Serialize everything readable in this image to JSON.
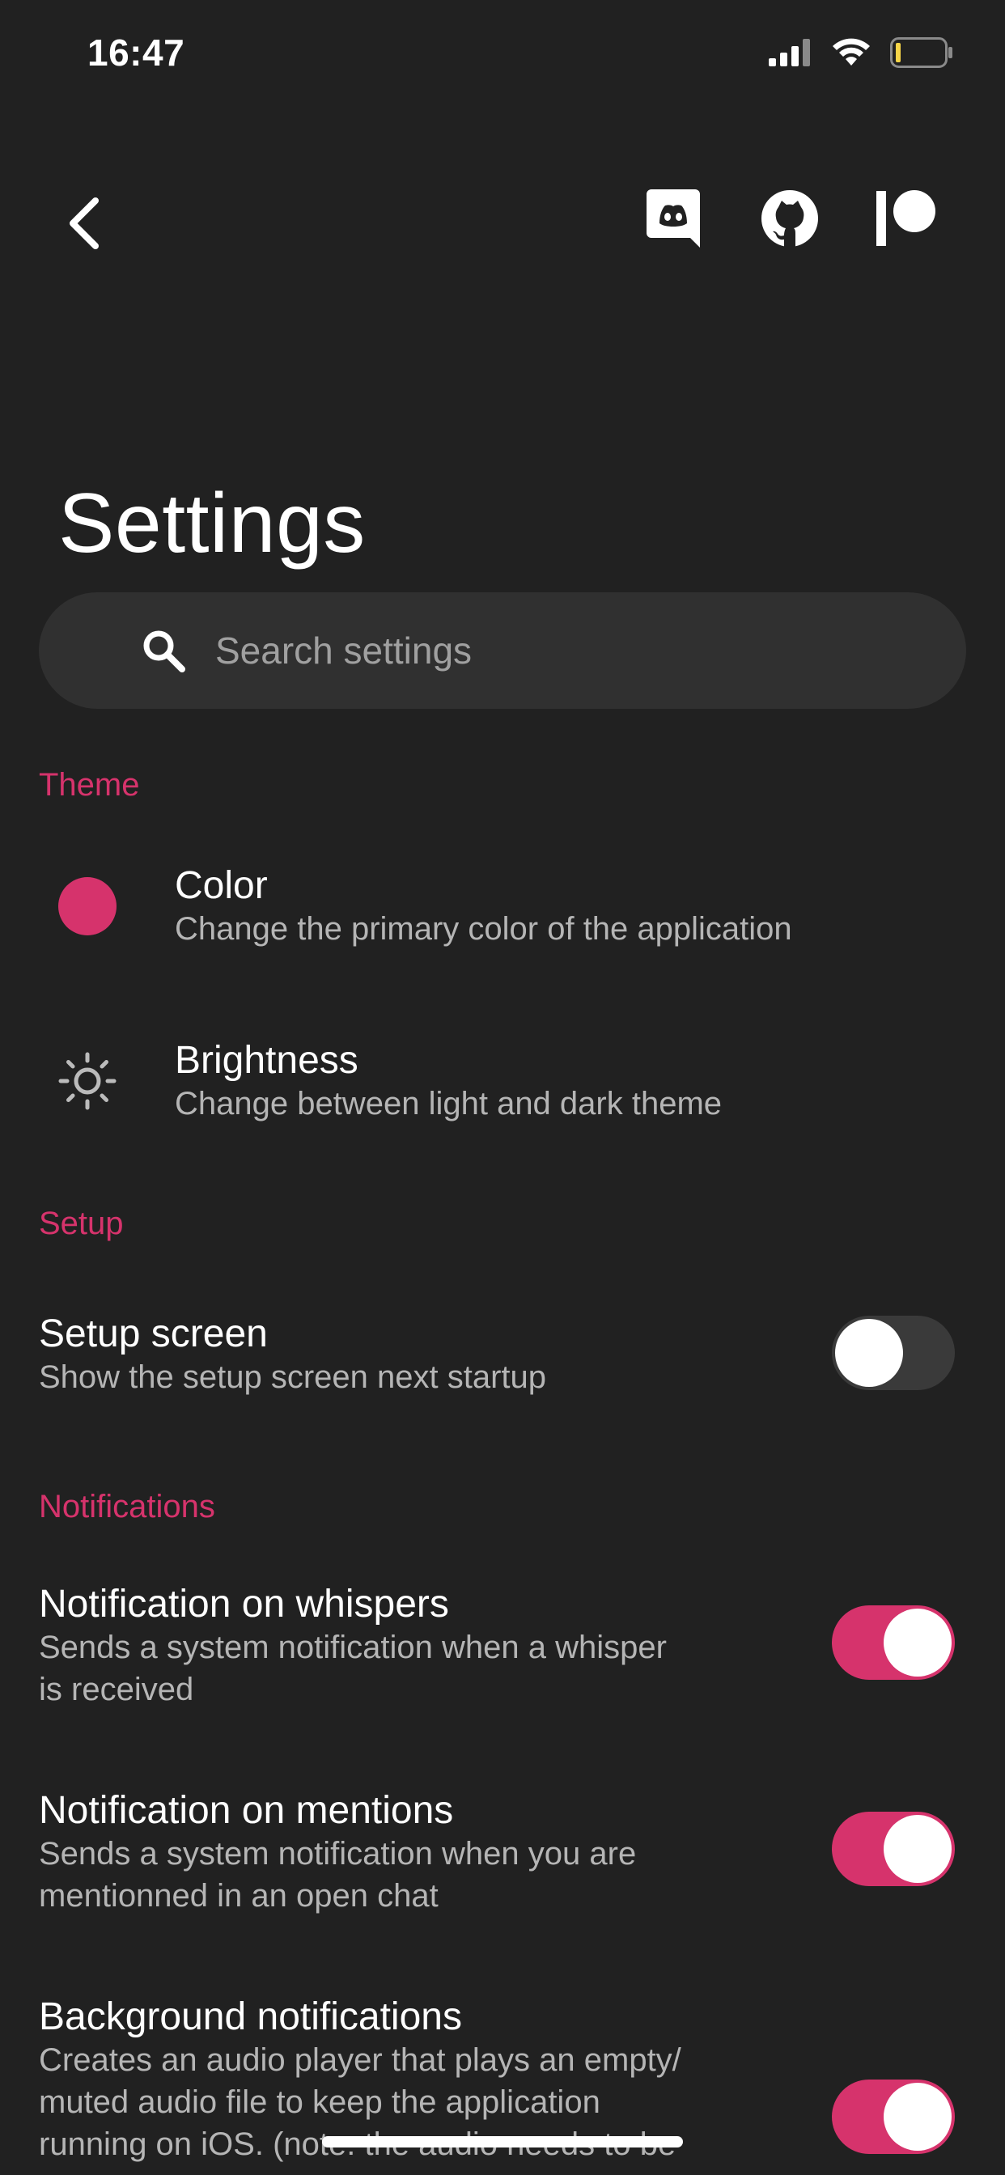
{
  "status_bar": {
    "time": "16:47",
    "icons": [
      "signal-icon",
      "wifi-icon",
      "battery-icon"
    ]
  },
  "app_bar": {
    "back_icon": "chevron-left-icon",
    "actions": [
      "discord-icon",
      "github-icon",
      "patreon-icon"
    ]
  },
  "page": {
    "title": "Settings"
  },
  "search": {
    "placeholder": "Search settings",
    "value": ""
  },
  "sections": {
    "theme": {
      "header": "Theme",
      "color": {
        "title": "Color",
        "subtitle": "Change the primary color of the application",
        "swatch": "#d6336c"
      },
      "brightness": {
        "title": "Brightness",
        "subtitle": "Change between light and dark theme",
        "icon": "sun-icon"
      }
    },
    "setup": {
      "header": "Setup",
      "setup_screen": {
        "title": "Setup screen",
        "subtitle": "Show the setup screen next startup",
        "enabled": false
      }
    },
    "notifications": {
      "header": "Notifications",
      "whispers": {
        "title": "Notification on whispers",
        "subtitle_line1": "Sends a system notification when a whisper",
        "subtitle_line2": "is received",
        "enabled": true
      },
      "mentions": {
        "title": "Notification on mentions",
        "subtitle_line1": "Sends a system notification when you are",
        "subtitle_line2": "mentionned in an open chat",
        "enabled": true
      },
      "background": {
        "title": "Background notifications",
        "subtitle_line1": "Creates an audio player that plays an empty/",
        "subtitle_line2": "muted audio file to keep the application",
        "subtitle_line3": "running on iOS. (note: the audio needs to be",
        "enabled": true
      }
    }
  },
  "colors": {
    "background": "#212121",
    "accent": "#d6336c",
    "surface": "#303030",
    "secondary_text": "#b5b5b5"
  }
}
